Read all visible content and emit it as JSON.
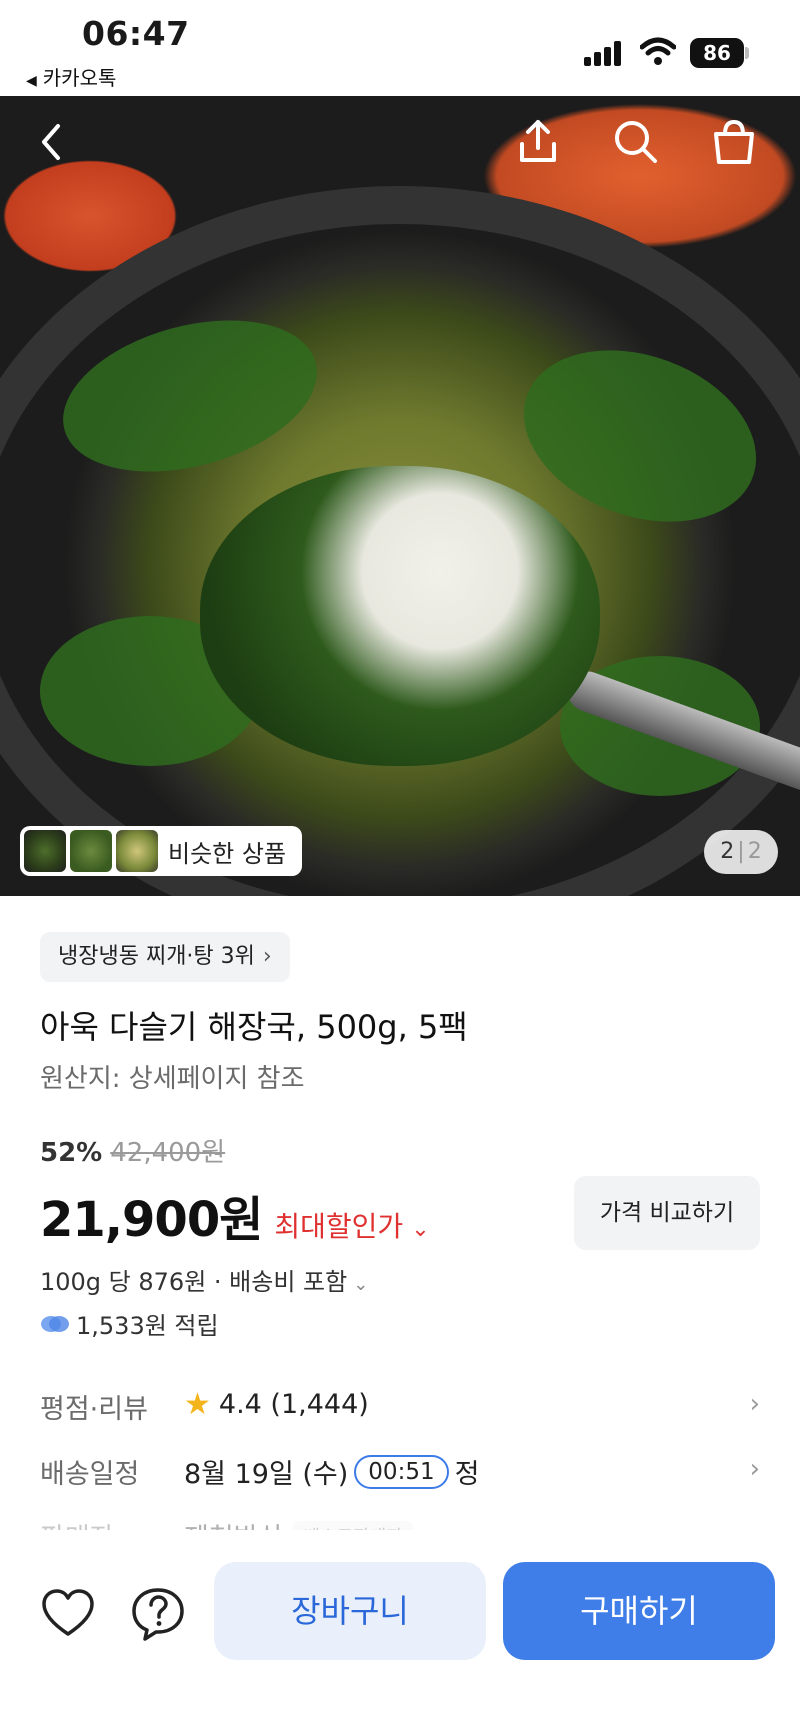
{
  "status_bar": {
    "time": "06:47",
    "back_app": "카카오톡",
    "battery": "86"
  },
  "hero": {
    "similar_label": "비슷한 상품",
    "page_current": "2",
    "page_total": "2"
  },
  "product": {
    "rank_chip": "냉장냉동 찌개·탕 3위",
    "title": "아욱 다슬기 해장국, 500g, 5팩",
    "origin": "원산지: 상세페이지 참조",
    "discount_rate": "52%",
    "original_price": "42,400원",
    "price": "21,900원",
    "price_label": "최대할인가",
    "compare_button": "가격 비교하기",
    "unit_price": "100g 당 876원 · 배송비 포함",
    "points": "1,533원 적립"
  },
  "info_rows": {
    "rating_label": "평점·리뷰",
    "rating_value": "4.4 (1,444)",
    "delivery_label": "배송일정",
    "delivery_value": "8월 19일 (수)",
    "delivery_timer": "00:51",
    "delivery_suffix": "정",
    "seller_label": "판매자",
    "seller_value": "제천방삭",
    "seller_badge": "베스트판매자"
  },
  "bottom_bar": {
    "cart_label": "장바구니",
    "buy_label": "구매하기"
  },
  "colors": {
    "accent_blue": "#3f7ee8",
    "price_red": "#e03131",
    "star_yellow": "#f4b51c"
  },
  "icons": [
    "back-arrow-icon",
    "share-icon",
    "search-icon",
    "shopping-bag-icon",
    "heart-icon",
    "help-icon",
    "star-icon",
    "points-icon",
    "chevron-right-icon",
    "chevron-down-icon"
  ]
}
